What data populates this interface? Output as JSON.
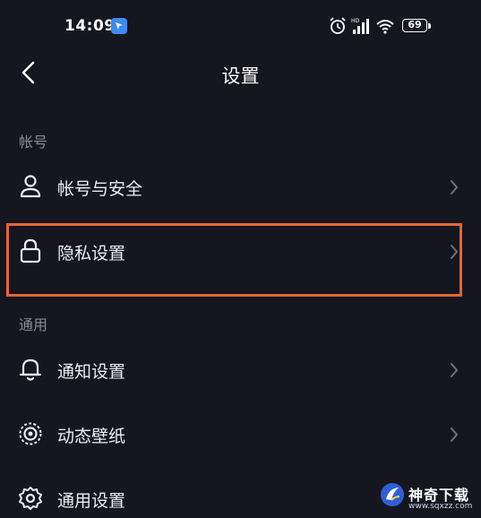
{
  "status_bar": {
    "time": "14:09",
    "battery": "69",
    "icons": [
      "app-notification-icon",
      "alarm-icon",
      "signal-icon",
      "wifi-icon",
      "battery-icon"
    ]
  },
  "header": {
    "title": "设置",
    "back_icon": "chevron-left-icon"
  },
  "sections": {
    "account": {
      "label": "帐号",
      "items": [
        {
          "label": "帐号与安全",
          "icon": "user-icon"
        },
        {
          "label": "隐私设置",
          "icon": "lock-icon"
        }
      ]
    },
    "general": {
      "label": "通用",
      "items": [
        {
          "label": "通知设置",
          "icon": "bell-icon"
        },
        {
          "label": "动态壁纸",
          "icon": "target-icon"
        },
        {
          "label": "通用设置",
          "icon": "gear-icon"
        }
      ]
    }
  },
  "highlight": {
    "color": "#e96434"
  },
  "watermark": {
    "text": "神奇下载",
    "url": "www.sqxzz.com"
  },
  "colors": {
    "background": "#15161e",
    "text": "#ececf1",
    "muted": "#8a8b94",
    "chevron": "#6f707a"
  }
}
